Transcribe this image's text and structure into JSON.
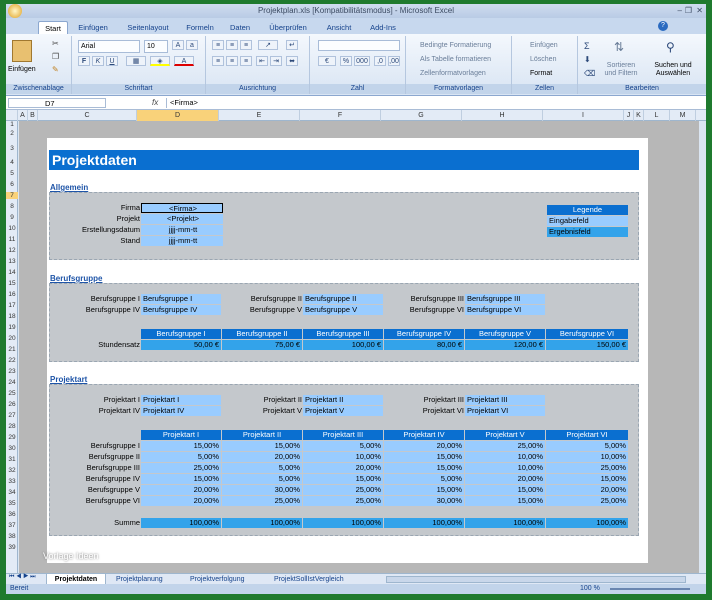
{
  "window": {
    "title": "Projektplan.xls [Kompatibilitätsmodus] - Microsoft Excel"
  },
  "ribbon_tabs": [
    "Start",
    "Einfügen",
    "Seitenlayout",
    "Formeln",
    "Daten",
    "Überprüfen",
    "Ansicht",
    "Add-Ins"
  ],
  "ribbon": {
    "clipboard": {
      "label": "Zwischenablage",
      "paste": "Einfügen"
    },
    "font": {
      "label": "Schriftart",
      "font_name": "Arial",
      "font_size": "10"
    },
    "alignment": {
      "label": "Ausrichtung"
    },
    "number": {
      "label": "Zahl"
    },
    "styles": {
      "label": "Formatvorlagen",
      "cond": "Bedingte Formatierung",
      "table": "Als Tabelle formatieren",
      "cellstyles": "Zellenformatvorlagen"
    },
    "cells": {
      "label": "Zellen",
      "insert": "Einfügen",
      "delete": "Löschen",
      "format": "Format"
    },
    "editing": {
      "label": "Bearbeiten",
      "sort": "Sortieren und Filtern",
      "find": "Suchen und Auswählen"
    }
  },
  "formula_bar": {
    "name_box": "D7",
    "fx": "fx",
    "content": "<Firma>"
  },
  "columns": [
    "A",
    "B",
    "C",
    "D",
    "E",
    "F",
    "G",
    "H",
    "I",
    "J",
    "K",
    "L",
    "M"
  ],
  "rows": [
    "1",
    "2",
    "3",
    "4",
    "5",
    "6",
    "7",
    "8",
    "9",
    "10",
    "11",
    "12",
    "13",
    "14",
    "15",
    "16",
    "17",
    "18",
    "19",
    "20",
    "21",
    "22",
    "23",
    "24",
    "25",
    "26",
    "27",
    "28",
    "29",
    "30",
    "31",
    "32",
    "33",
    "34",
    "35",
    "36",
    "37",
    "38",
    "39"
  ],
  "sheet": {
    "title": "Projektdaten",
    "allgemein": {
      "heading": "Allgemein",
      "fields": [
        {
          "label": "Firma",
          "value": "<Firma>"
        },
        {
          "label": "Projekt",
          "value": "<Projekt>"
        },
        {
          "label": "Erstellungsdatum",
          "value": "jjjj-mm-tt"
        },
        {
          "label": "Stand",
          "value": "jjjj-mm-tt"
        }
      ],
      "legend": {
        "title": "Legende",
        "input": "Eingabefeld",
        "result": "Ergebnisfeld"
      }
    },
    "berufsgruppe": {
      "heading": "Berufsgruppe",
      "pairs": [
        {
          "label": "Berufsgruppe I",
          "value": "Berufsgruppe I"
        },
        {
          "label": "Berufsgruppe II",
          "value": "Berufsgruppe II"
        },
        {
          "label": "Berufsgruppe III",
          "value": "Berufsgruppe III"
        },
        {
          "label": "Berufsgruppe IV",
          "value": "Berufsgruppe IV"
        },
        {
          "label": "Berufsgruppe V",
          "value": "Berufsgruppe V"
        },
        {
          "label": "Berufsgruppe VI",
          "value": "Berufsgruppe VI"
        }
      ],
      "rate_headers": [
        "Berufsgruppe I",
        "Berufsgruppe II",
        "Berufsgruppe III",
        "Berufsgruppe IV",
        "Berufsgruppe V",
        "Berufsgruppe VI"
      ],
      "rate_label": "Stundensatz",
      "rates": [
        "50,00 €",
        "75,00 €",
        "100,00 €",
        "80,00 €",
        "120,00 €",
        "150,00 €"
      ]
    },
    "projektart": {
      "heading": "Projektart",
      "pairs": [
        {
          "label": "Projektart I",
          "value": "Projektart I"
        },
        {
          "label": "Projektart II",
          "value": "Projektart II"
        },
        {
          "label": "Projektart III",
          "value": "Projektart III"
        },
        {
          "label": "Projektart IV",
          "value": "Projektart IV"
        },
        {
          "label": "Projektart V",
          "value": "Projektart V"
        },
        {
          "label": "Projektart VI",
          "value": "Projektart VI"
        }
      ],
      "headers": [
        "Projektart I",
        "Projektart II",
        "Projektart III",
        "Projektart IV",
        "Projektart V",
        "Projektart VI"
      ],
      "matrix": [
        {
          "label": "Berufsgruppe I",
          "values": [
            "15,00%",
            "15,00%",
            "5,00%",
            "20,00%",
            "25,00%",
            "5,00%"
          ]
        },
        {
          "label": "Berufsgruppe II",
          "values": [
            "5,00%",
            "20,00%",
            "10,00%",
            "15,00%",
            "10,00%",
            "10,00%"
          ]
        },
        {
          "label": "Berufsgruppe III",
          "values": [
            "25,00%",
            "5,00%",
            "20,00%",
            "15,00%",
            "10,00%",
            "25,00%"
          ]
        },
        {
          "label": "Berufsgruppe IV",
          "values": [
            "15,00%",
            "5,00%",
            "15,00%",
            "5,00%",
            "20,00%",
            "15,00%"
          ]
        },
        {
          "label": "Berufsgruppe V",
          "values": [
            "20,00%",
            "30,00%",
            "25,00%",
            "15,00%",
            "15,00%",
            "20,00%"
          ]
        },
        {
          "label": "Berufsgruppe VI",
          "values": [
            "20,00%",
            "25,00%",
            "25,00%",
            "30,00%",
            "15,00%",
            "25,00%"
          ]
        }
      ],
      "sum_label": "Summe",
      "sums": [
        "100,00%",
        "100,00%",
        "100,00%",
        "100,00%",
        "100,00%",
        "100,00%"
      ]
    },
    "watermark": "Vorlage Ideen"
  },
  "sheet_tabs": [
    "Projektdaten",
    "Projektplanung",
    "Projektverfolgung",
    "ProjektSollIstVergleich"
  ],
  "status": {
    "ready": "Bereit",
    "zoom": "100 %"
  },
  "colors": {
    "dark": "#0a6fd0",
    "mid": "#33a3ea",
    "light": "#99ccff",
    "grey": "#c4c8cc"
  }
}
